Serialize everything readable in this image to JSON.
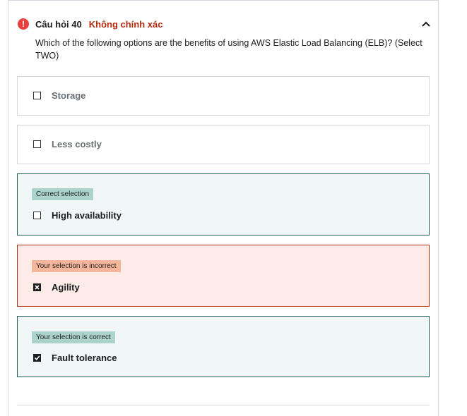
{
  "question": {
    "number": "Câu hỏi 40",
    "status": "Không chính xác",
    "text": "Which of the following options are the benefits of using AWS Elastic Load Balancing (ELB)? (Select TWO)"
  },
  "options": [
    {
      "label": "Storage",
      "badge": "",
      "checked": false,
      "state": "plain"
    },
    {
      "label": "Less costly",
      "badge": "",
      "checked": false,
      "state": "plain"
    },
    {
      "label": "High availability",
      "badge": "Correct selection",
      "checked": false,
      "state": "correct"
    },
    {
      "label": "Agility",
      "badge": "Your selection is incorrect",
      "checked": true,
      "state": "incorrect"
    },
    {
      "label": "Fault tolerance",
      "badge": "Your selection is correct",
      "checked": true,
      "state": "correct"
    }
  ],
  "colors": {
    "error": "#e8413d",
    "status_text": "#b32d0f",
    "correct_border": "#1e6055",
    "correct_bg": "#f1f7f6",
    "correct_badge": "#acd2cc",
    "incorrect_border": "#b32d0f",
    "incorrect_bg": "#fcebe7",
    "incorrect_badge": "#f6b69b"
  },
  "icons": {
    "status": "alert-circle-icon",
    "collapse": "chevron-up-icon",
    "checked": "check-icon",
    "wrong": "x-icon"
  }
}
